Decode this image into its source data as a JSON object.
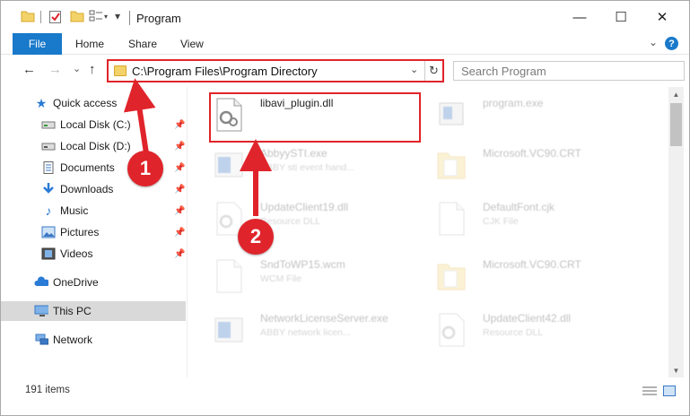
{
  "window": {
    "title": "Program",
    "controls": {
      "minimize": "—",
      "maximize": "☐",
      "close": "✕"
    }
  },
  "ribbon": {
    "tabs": [
      {
        "label": "File",
        "active": true
      },
      {
        "label": "Home"
      },
      {
        "label": "Share"
      },
      {
        "label": "View"
      }
    ]
  },
  "nav": {
    "back_icon": "←",
    "forward_icon": "→",
    "dropdown_icon": "⌄",
    "up_icon": "↑",
    "address": "C:\\Program Files\\Program Directory",
    "search_placeholder": "Search Program"
  },
  "sidebar": {
    "quick_access": "Quick access",
    "pinned": [
      {
        "label": "Local Disk (C:)",
        "icon": "drive-icon"
      },
      {
        "label": "Local Disk (D:)",
        "icon": "drive-icon"
      },
      {
        "label": "Documents",
        "icon": "documents-icon"
      },
      {
        "label": "Downloads",
        "icon": "downloads-icon"
      },
      {
        "label": "Music",
        "icon": "music-icon"
      },
      {
        "label": "Pictures",
        "icon": "pictures-icon"
      },
      {
        "label": "Videos",
        "icon": "videos-icon"
      }
    ],
    "onedrive": "OneDrive",
    "this_pc": "This PC",
    "network": "Network"
  },
  "files": {
    "left_column": [
      {
        "name": "libavi_plugin.dll",
        "desc": ""
      },
      {
        "name": "AbbyySTI.exe",
        "desc": "ABBY sti event hand..."
      },
      {
        "name": "UpdateClient19.dll",
        "desc": "Resource DLL"
      },
      {
        "name": "SndToWP15.wcm",
        "desc": "WCM File"
      },
      {
        "name": "NetworkLicenseServer.exe",
        "desc": "ABBY network licen..."
      }
    ],
    "right_column": [
      {
        "name": "program.exe",
        "desc": ""
      },
      {
        "name": "Microsoft.VC90.CRT",
        "desc": ""
      },
      {
        "name": "DefaultFont.cjk",
        "desc": "CJK File"
      },
      {
        "name": "Microsoft.VC90.CRT",
        "desc": ""
      },
      {
        "name": "UpdateClient42.dll",
        "desc": "Resource DLL"
      }
    ]
  },
  "status": {
    "item_count": "191 items"
  },
  "annotations": {
    "step1": "1",
    "step2": "2"
  },
  "colors": {
    "accent": "#1979ca",
    "highlight": "#e0242b"
  }
}
